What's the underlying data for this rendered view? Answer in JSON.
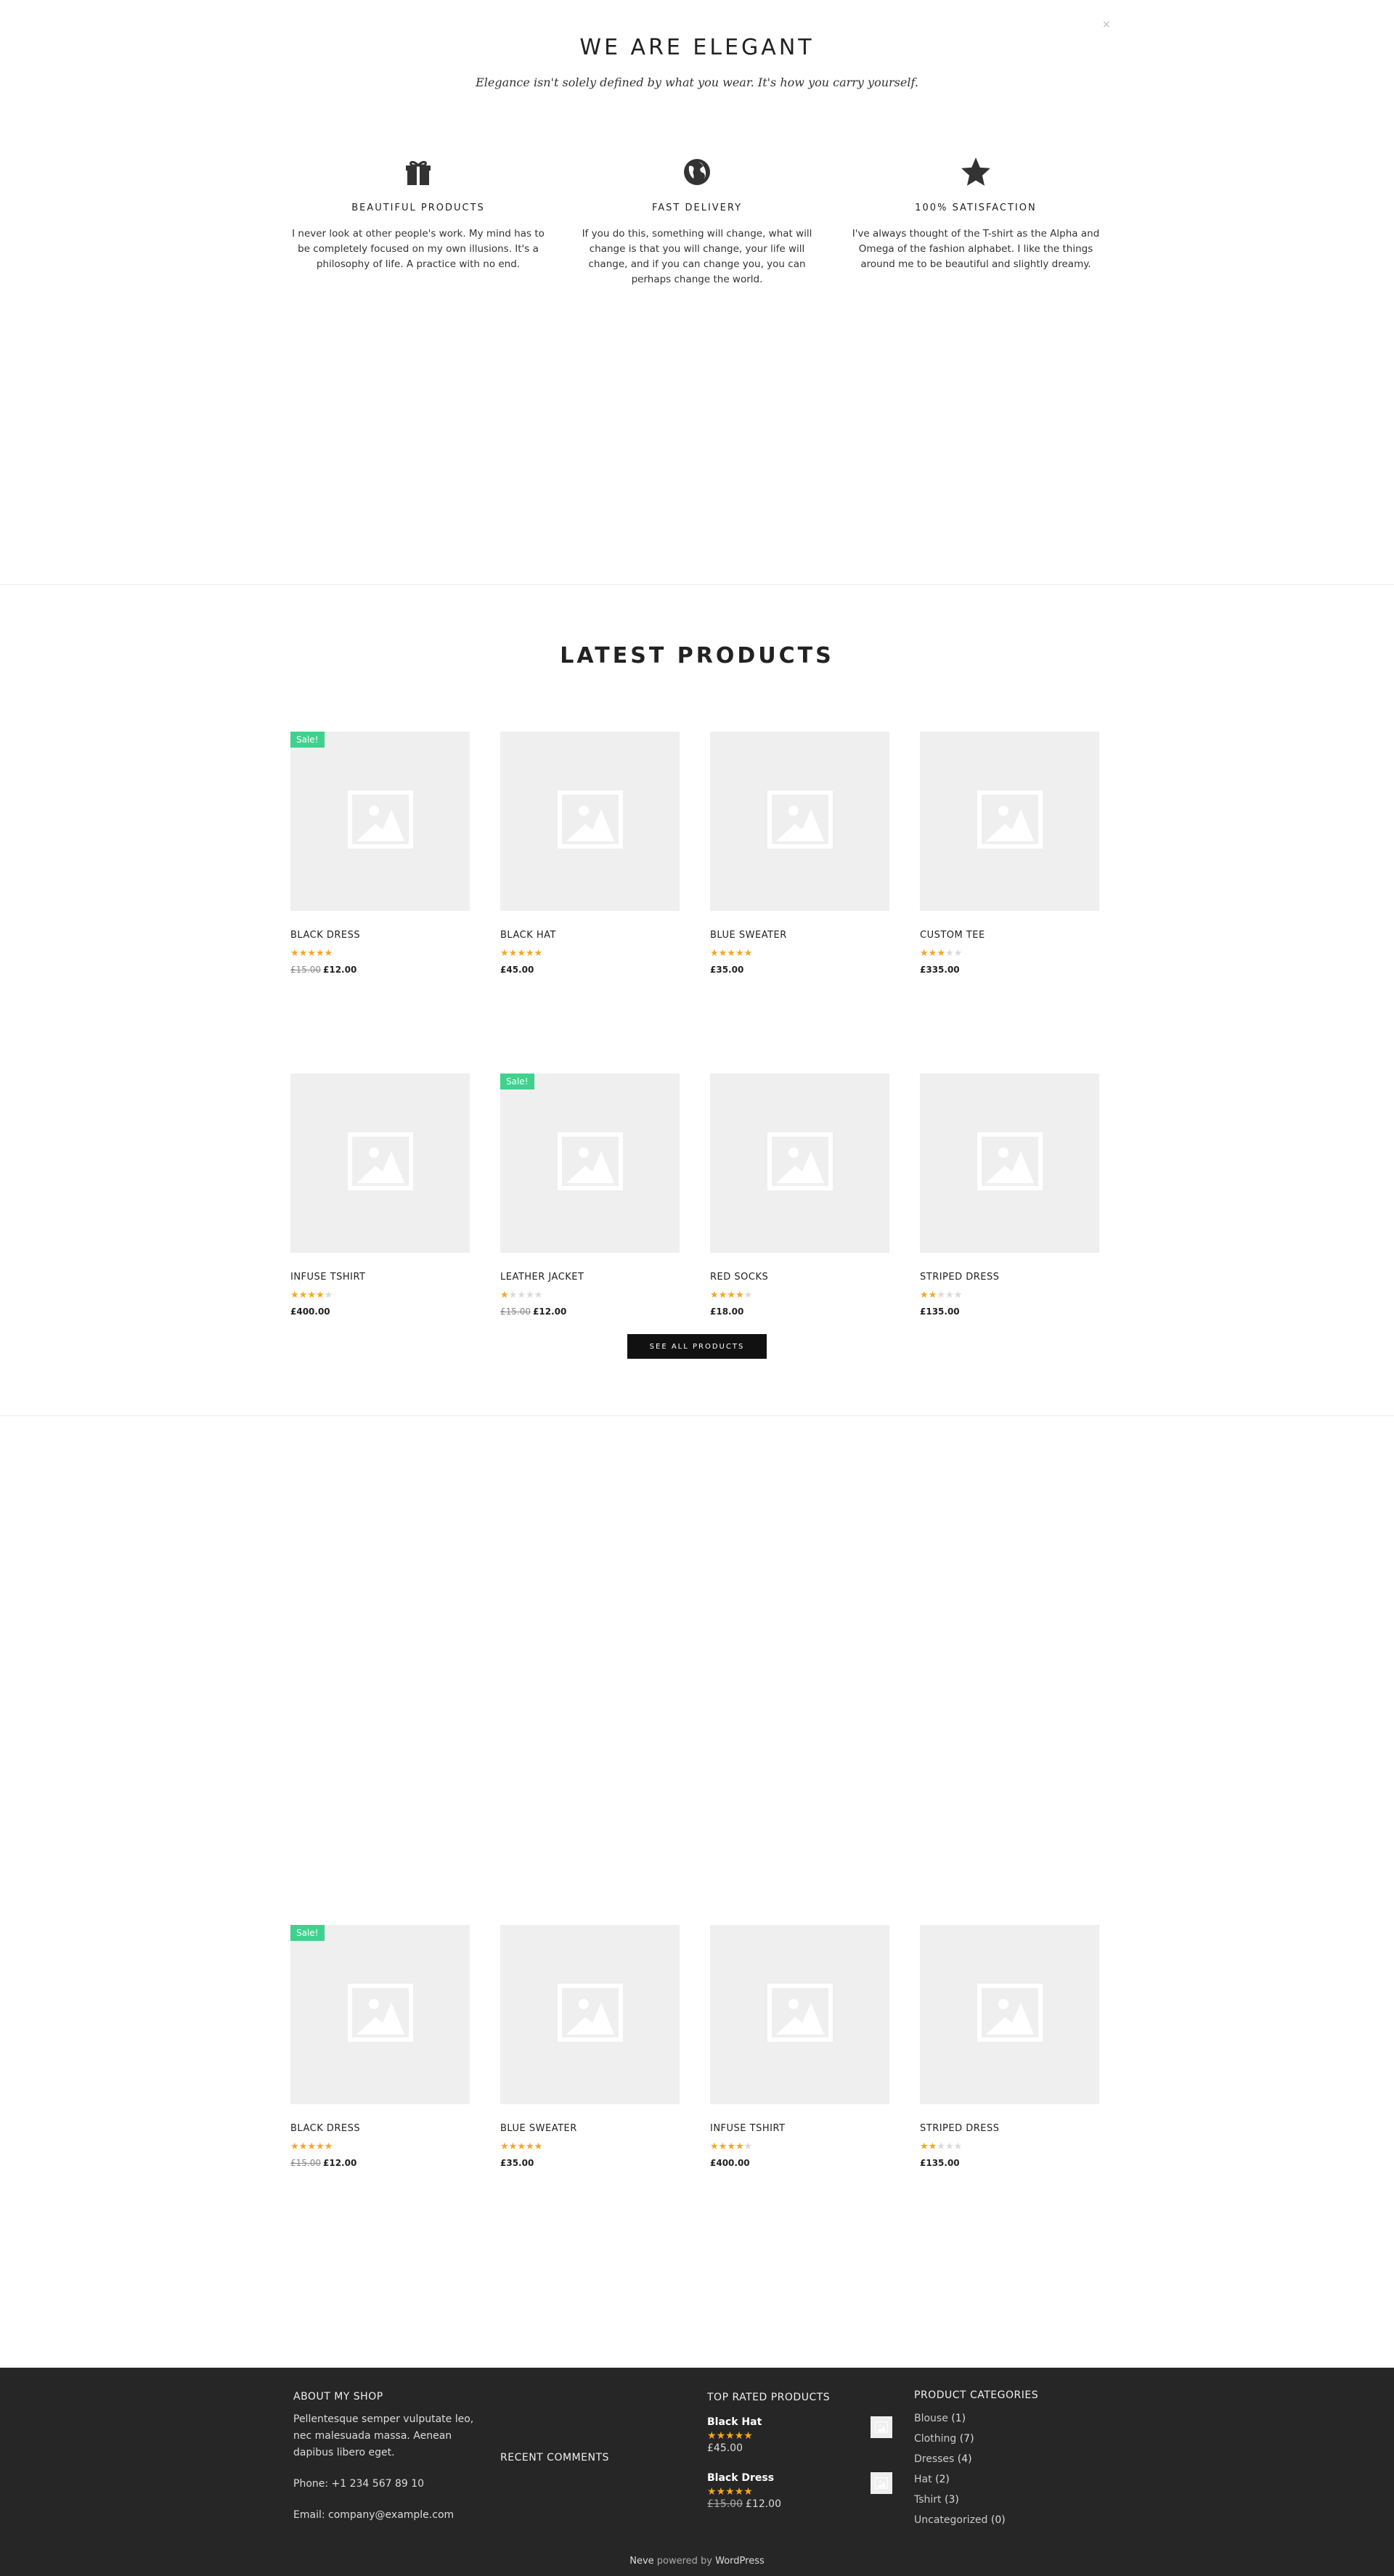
{
  "close_symbol": "×",
  "elegant": {
    "title": "WE ARE ELEGANT",
    "subtitle": "Elegance isn't solely defined by what you wear. It's how you carry yourself.",
    "features": [
      {
        "icon": "gift-icon",
        "title": "BEAUTIFUL PRODUCTS",
        "text": "I never look at other people's work. My mind has to be completely focused on my own illusions. It's a philosophy of life. A practice with no end."
      },
      {
        "icon": "globe-icon",
        "title": "FAST DELIVERY",
        "text": "If you do this, something will change, what will change is that you will change, your life will change, and if you can change you, you can perhaps change the world."
      },
      {
        "icon": "star-icon",
        "title": "100% SATISFACTION",
        "text": "I've always thought of the T-shirt as the Alpha and Omega of the fashion alphabet. I like the things around me to be beautiful and slightly dreamy."
      }
    ]
  },
  "latest": {
    "title": "LATEST PRODUCTS",
    "see_all": "SEE ALL PRODUCTS",
    "products": [
      {
        "name": "BLACK DRESS",
        "rating": 5,
        "old_price": "£15.00",
        "price": "£12.00",
        "sale": "Sale!"
      },
      {
        "name": "BLACK HAT",
        "rating": 5,
        "old_price": "",
        "price": "£45.00",
        "sale": ""
      },
      {
        "name": "BLUE SWEATER",
        "rating": 5,
        "old_price": "",
        "price": "£35.00",
        "sale": ""
      },
      {
        "name": "CUSTOM TEE",
        "rating": 3,
        "old_price": "",
        "price": "£335.00",
        "sale": ""
      },
      {
        "name": "INFUSE TSHIRT",
        "rating": 4,
        "old_price": "",
        "price": "£400.00",
        "sale": ""
      },
      {
        "name": "LEATHER JACKET",
        "rating": 1,
        "old_price": "£15.00",
        "price": "£12.00",
        "sale": "Sale!"
      },
      {
        "name": "RED SOCKS",
        "rating": 4,
        "old_price": "",
        "price": "£18.00",
        "sale": ""
      },
      {
        "name": "STRIPED DRESS",
        "rating": 2,
        "old_price": "",
        "price": "£135.00",
        "sale": ""
      }
    ]
  },
  "featured": {
    "products": [
      {
        "name": "BLACK DRESS",
        "rating": 5,
        "old_price": "£15.00",
        "price": "£12.00",
        "sale": "Sale!"
      },
      {
        "name": "BLUE SWEATER",
        "rating": 5,
        "old_price": "",
        "price": "£35.00",
        "sale": ""
      },
      {
        "name": "INFUSE TSHIRT",
        "rating": 4,
        "old_price": "",
        "price": "£400.00",
        "sale": ""
      },
      {
        "name": "STRIPED DRESS",
        "rating": 2,
        "old_price": "",
        "price": "£135.00",
        "sale": ""
      }
    ]
  },
  "footer": {
    "about_title": "ABOUT MY SHOP",
    "about_text": "Pellentesque semper vulputate leo, nec malesuada massa. Aenean dapibus libero eget.",
    "phone": "Phone: +1 234 567 89 10",
    "email_label": "Email: ",
    "email": "company@example.com",
    "recent_comments_title": "RECENT COMMENTS",
    "top_rated_title": "TOP RATED PRODUCTS",
    "top_rated": [
      {
        "name": "Black Hat",
        "rating": 5,
        "old_price": "",
        "price": "£45.00"
      },
      {
        "name": "Black Dress",
        "rating": 5,
        "old_price": "£15.00",
        "price": "£12.00"
      }
    ],
    "categories_title": "PRODUCT CATEGORIES",
    "categories": [
      {
        "name": "Blouse",
        "count": "(1)"
      },
      {
        "name": "Clothing",
        "count": "(7)"
      },
      {
        "name": "Dresses",
        "count": "(4)"
      },
      {
        "name": "Hat",
        "count": "(2)"
      },
      {
        "name": "Tshirt",
        "count": "(3)"
      },
      {
        "name": "Uncategorized",
        "count": "(0)"
      }
    ],
    "powered_theme": "Neve",
    "powered_by": " powered by ",
    "powered_platform": "WordPress"
  },
  "colors": {
    "sale_badge": "#3ed28e",
    "star": "#f5a623",
    "footer_bg": "#262626",
    "button_bg": "#111111"
  }
}
